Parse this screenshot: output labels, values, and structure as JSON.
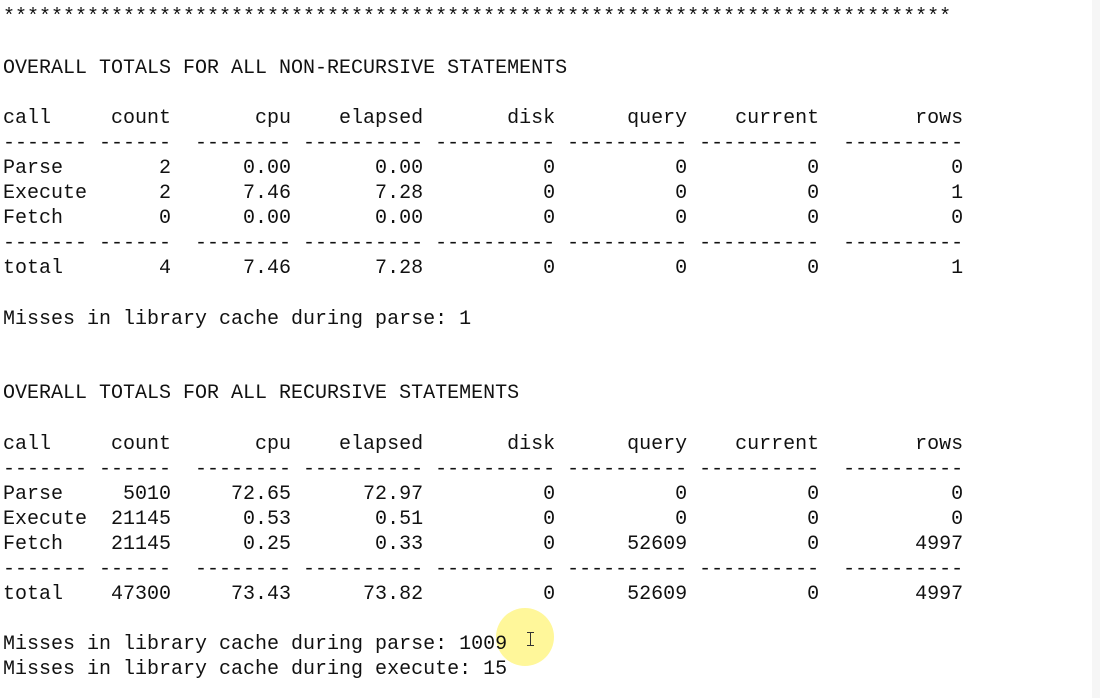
{
  "report": {
    "separator": "*******************************************************************************",
    "nonrecursive": {
      "title": "OVERALL TOTALS FOR ALL NON-RECURSIVE STATEMENTS",
      "header": "call     count       cpu    elapsed       disk      query    current        rows",
      "rule": "------- ------  -------- ---------- ---------- ---------- ----------  ----------",
      "rows": [
        "Parse        2      0.00       0.00          0          0          0           0",
        "Execute      2      7.46       7.28          0          0          0           1",
        "Fetch        0      0.00       0.00          0          0          0           0"
      ],
      "total": "total        4      7.46       7.28          0          0          0           1",
      "misses_parse": "Misses in library cache during parse: 1"
    },
    "recursive": {
      "title": "OVERALL TOTALS FOR ALL RECURSIVE STATEMENTS",
      "header": "call     count       cpu    elapsed       disk      query    current        rows",
      "rule": "------- ------  -------- ---------- ---------- ---------- ----------  ----------",
      "rows": [
        "Parse     5010     72.65      72.97          0          0          0           0",
        "Execute  21145      0.53       0.51          0          0          0           0",
        "Fetch    21145      0.25       0.33          0      52609          0        4997"
      ],
      "total": "total    47300     73.43      73.82          0      52609          0        4997",
      "misses_parse": "Misses in library cache during parse: 1009",
      "misses_execute": "Misses in library cache during execute: 15"
    }
  }
}
